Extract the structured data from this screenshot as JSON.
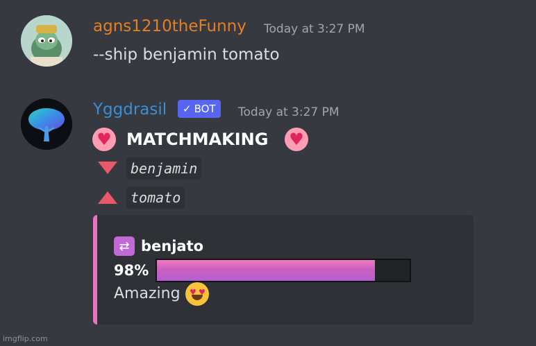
{
  "messages": [
    {
      "author": "agns1210theFunny",
      "timestamp": "Today at 3:27 PM",
      "content": "--ship benjamin tomato",
      "author_color": "#e67e22"
    },
    {
      "author": "Yggdrasil",
      "bot_tag": "BOT",
      "timestamp": "Today at 3:27 PM",
      "author_color": "#3a8fd6",
      "heading": "MATCHMAKING",
      "name_down": "benjamin",
      "name_up": "tomato",
      "embed": {
        "title": "benjato",
        "percent_label": "98%",
        "percent_value": 0.98,
        "verdict": "Amazing",
        "accent_color": "#ee72c2"
      }
    }
  ],
  "icons": {
    "heart_left": "heart-icon",
    "heart_right": "heart-icon",
    "shuffle": "shuffle-icon",
    "verified": "checkmark-icon",
    "emoji": "heart-eyes-emoji"
  },
  "watermark": "imgflip.com"
}
